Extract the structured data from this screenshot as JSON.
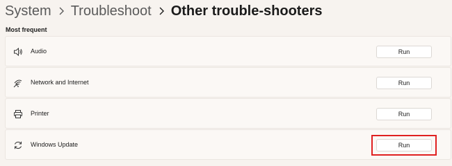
{
  "breadcrumb": {
    "items": [
      "System",
      "Troubleshoot",
      "Other trouble-shooters"
    ]
  },
  "section": {
    "title": "Most frequent"
  },
  "troubleshooters": [
    {
      "label": "Audio",
      "icon": "speaker-icon",
      "button": "Run"
    },
    {
      "label": "Network and Internet",
      "icon": "wifi-icon",
      "button": "Run"
    },
    {
      "label": "Printer",
      "icon": "printer-icon",
      "button": "Run"
    },
    {
      "label": "Windows Update",
      "icon": "refresh-icon",
      "button": "Run"
    }
  ],
  "colors": {
    "background": "#f7f3ef",
    "card": "#fbf8f5",
    "highlight": "#e02020"
  }
}
